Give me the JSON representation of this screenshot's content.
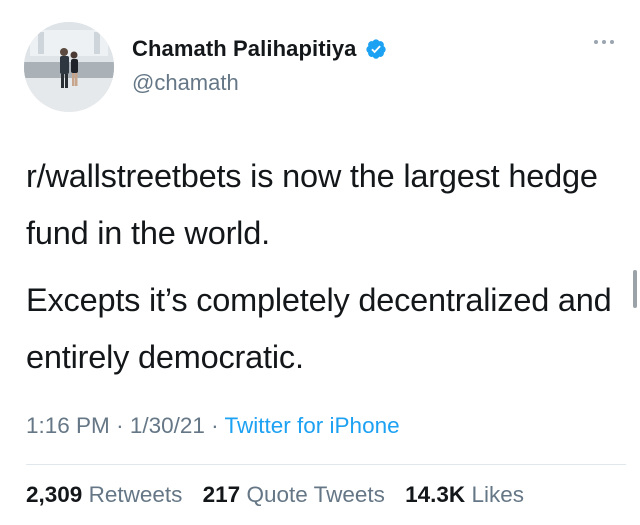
{
  "author": {
    "display_name": "Chamath Palihapitiya",
    "handle": "@chamath",
    "verified_icon": "verified-badge-icon",
    "avatar_icon": "profile-photo"
  },
  "tweet": {
    "paragraphs": [
      "r/wallstreetbets is now the largest hedge fund in the world.",
      "Excepts it’s completely decentralized and entirely democratic."
    ]
  },
  "meta": {
    "time": "1:16 PM",
    "separator": "·",
    "date": "1/30/21",
    "source": "Twitter for iPhone"
  },
  "stats": {
    "retweets_count": "2,309",
    "retweets_label": "Retweets",
    "quotes_count": "217",
    "quotes_label": "Quote Tweets",
    "likes_count": "14.3K",
    "likes_label": "Likes"
  },
  "colors": {
    "accent": "#1da1f2",
    "secondary_text": "#657786",
    "primary_text": "#14171a"
  }
}
